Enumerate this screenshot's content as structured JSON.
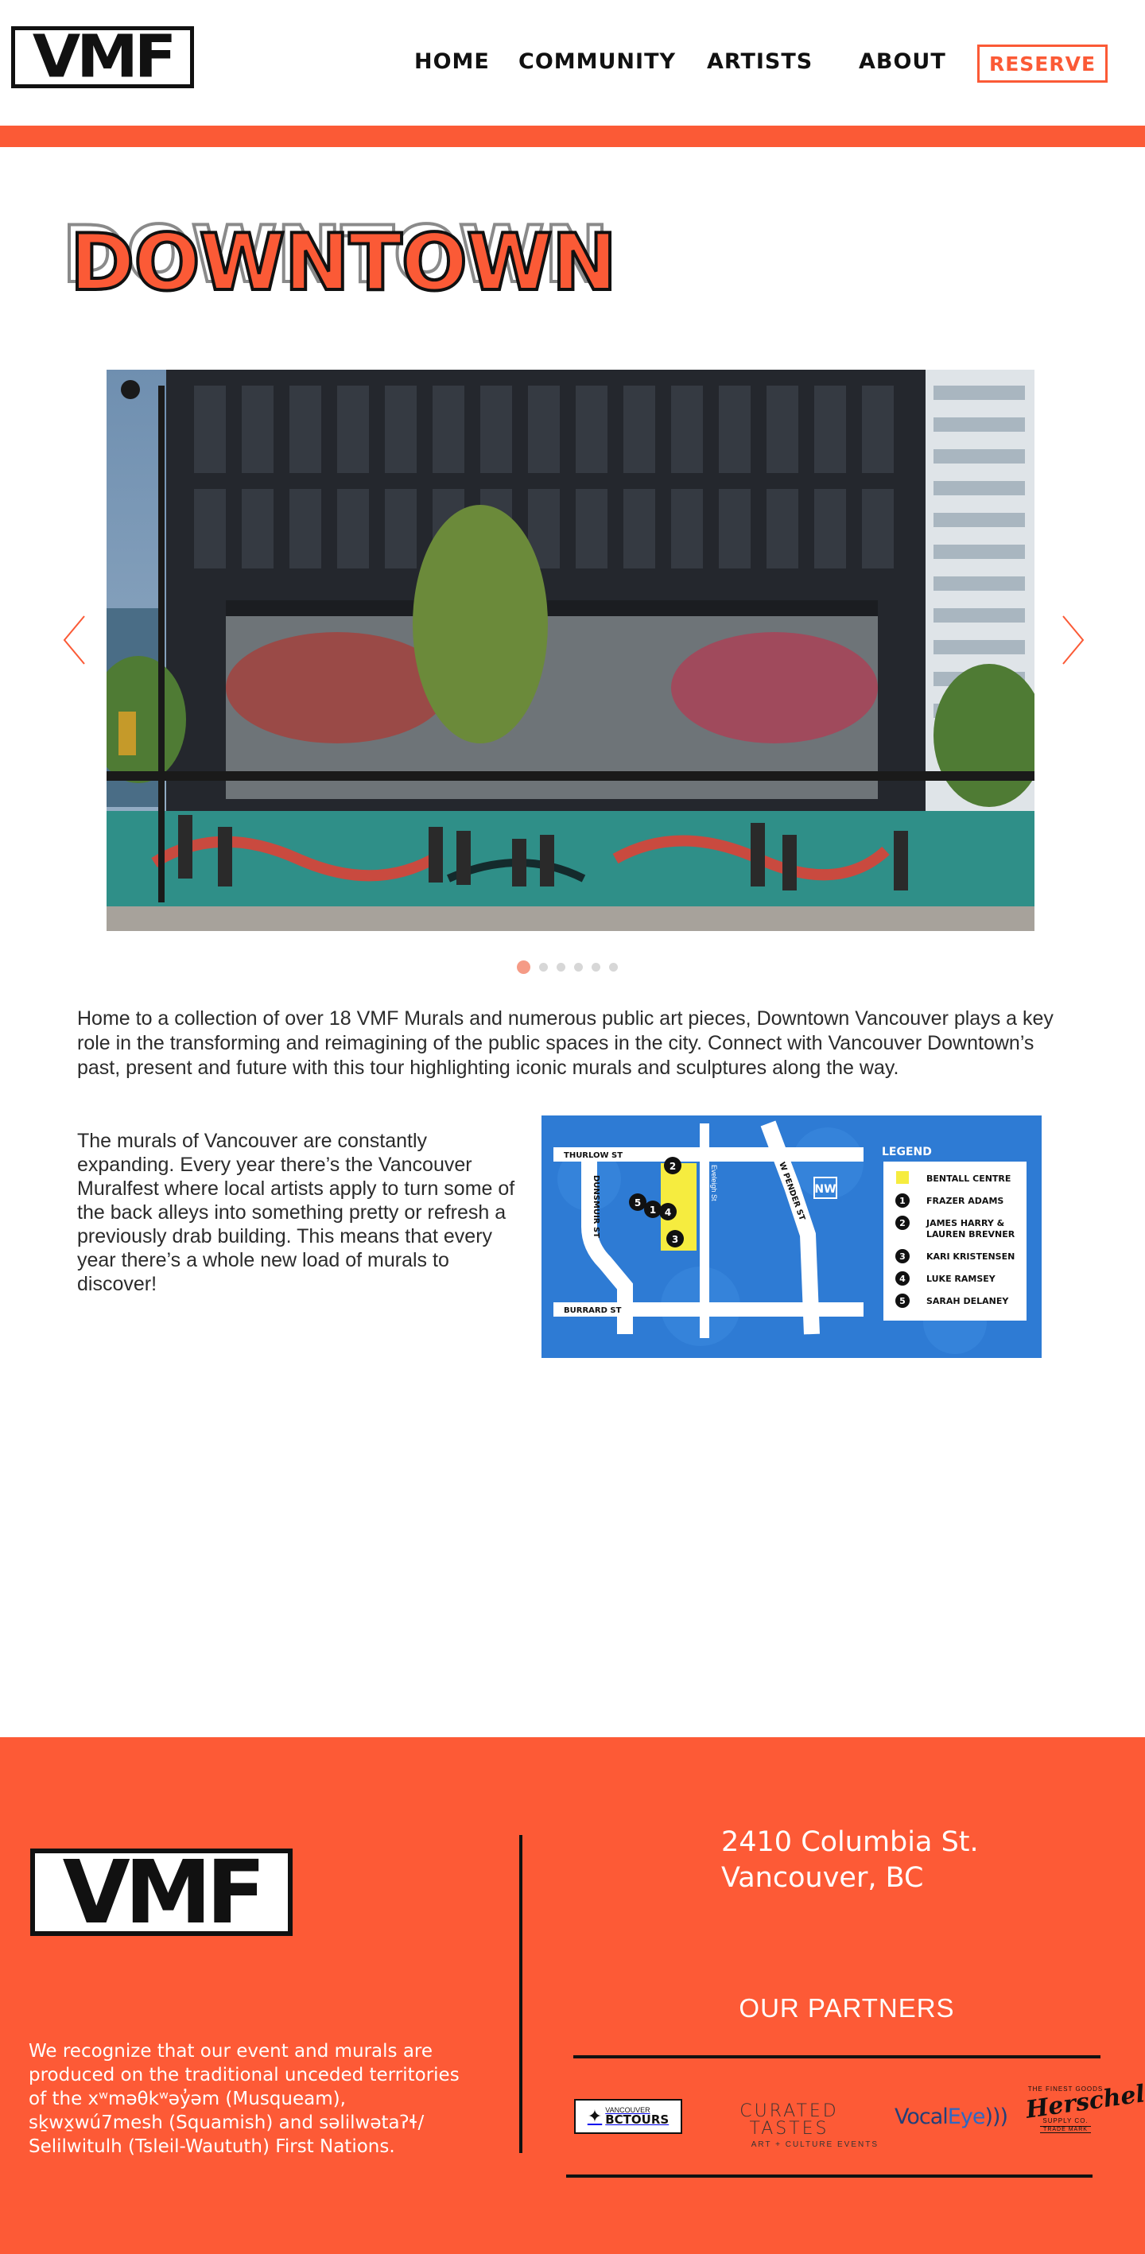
{
  "header": {
    "logo_text": "VMF",
    "nav": [
      {
        "label": "HOME"
      },
      {
        "label": "COMMUNITY"
      },
      {
        "label": "ARTISTS"
      },
      {
        "label": "ABOUT"
      }
    ],
    "reserve_label": "RESERVE"
  },
  "colors": {
    "accent": "#fb5a36",
    "footer_bg": "#fd5a36",
    "map_blue": "#2e7bd4",
    "map_yellow": "#f6ec3f"
  },
  "page_title": "DOWNTOWN",
  "carousel": {
    "slide_count": 6,
    "active_index": 0,
    "prev_icon": "chevron-left-icon",
    "next_icon": "chevron-right-icon"
  },
  "intro_text": "Home to a collection of over 18 VMF Murals and numerous public art pieces, Downtown Vancouver plays a key role in the transforming and reimagining of the public spaces in the city. Connect with Vancouver Downtown’s past, present and future with this tour highlighting iconic murals and sculptures along the way.",
  "body_text": "The murals of Vancouver are constantly expanding. Every year there’s the Vancouver Muralfest where local artists apply to turn some of the back alleys into something pretty or refresh a previously drab building. This means that every year there’s a whole new load of murals to discover!",
  "map": {
    "streets": {
      "thurlow": "THURLOW ST",
      "burrard": "BURRARD ST",
      "dunsmuir": "DUNSMUIR ST",
      "pender": "W PENDER ST",
      "eveleigh": "Eveleigh St"
    },
    "compass": "NW",
    "legend_title": "LEGEND",
    "legend": [
      {
        "marker": "",
        "label": "BENTALL CENTRE"
      },
      {
        "marker": "1",
        "label": "FRAZER ADAMS"
      },
      {
        "marker": "2",
        "label": "JAMES HARRY &"
      },
      {
        "marker": "",
        "label": "LAUREN BREVNER"
      },
      {
        "marker": "3",
        "label": "KARI KRISTENSEN"
      },
      {
        "marker": "4",
        "label": "LUKE RAMSEY"
      },
      {
        "marker": "5",
        "label": "SARAH DELANEY"
      }
    ],
    "pins": [
      "1",
      "2",
      "3",
      "4",
      "5"
    ]
  },
  "footer": {
    "logo_text": "VMF",
    "address_line1": "2410 Columbia St.",
    "address_line2": "Vancouver, BC",
    "land_acknowledgement": "We recognize that our event and murals are produced on the traditional unceded territories of the xʷməθkʷəy̓əm (Musqueam), sḵwx̱wú7mesh (Squamish) and səlilwətaʔɬ/ Selilwitulh (Tsleil-Waututh) First Nations.",
    "partners_title": "OUR PARTNERS",
    "partners": {
      "bc_small": "VANCOUVER",
      "bc_big": "BCTOURS",
      "curated_main": "CURATED TASTES",
      "curated_sub": "ART + CULTURE EVENTS",
      "vocal_a": "Vocal",
      "vocal_b": "Eye",
      "vocal_c": ")))",
      "herschel_small": "THE FINEST GOODS",
      "herschel_main": "Herschel",
      "herschel_tag": "SUPPLY CO.",
      "herschel_sub": "TRADE MARK"
    }
  }
}
